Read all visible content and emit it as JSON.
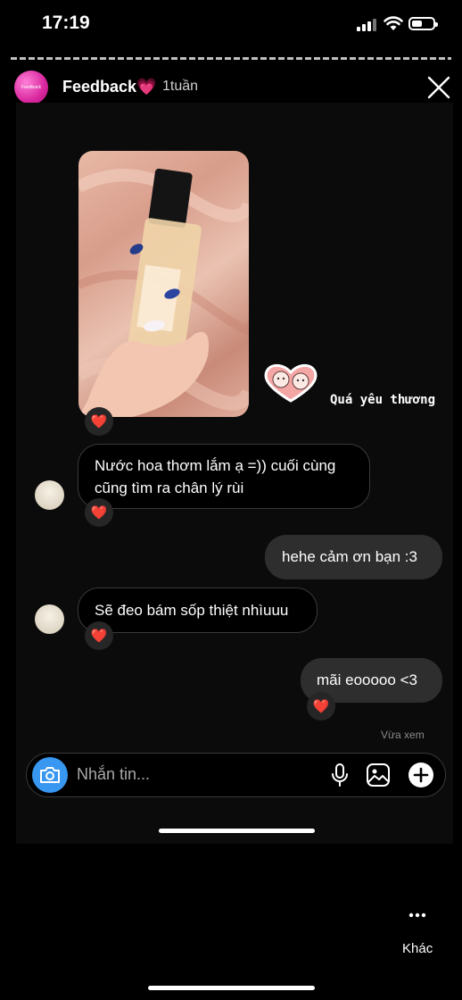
{
  "status_bar": {
    "time": "17:19"
  },
  "header": {
    "account_name": "Feedback💗",
    "avatar_text": "Feedback",
    "age": "1tuần"
  },
  "sticker": {
    "text": "Quá yêu thương"
  },
  "messages": [
    {
      "text": "Nước hoa thơm lắm ạ =)) cuối cùng cũng tìm ra chân lý rùi",
      "direction": "incoming"
    },
    {
      "text": "hehe cảm ơn bạn :3",
      "direction": "outgoing"
    },
    {
      "text": "Sẽ đeo bám sốp thiệt nhìuuu",
      "direction": "incoming"
    },
    {
      "text": "mãi eooooo <3",
      "direction": "outgoing"
    }
  ],
  "reaction": "❤️",
  "seen_label": "Vừa xem",
  "composer": {
    "placeholder": "Nhắn tin..."
  },
  "footer": {
    "more_label": "Khác"
  },
  "colors": {
    "background": "#000000",
    "camera_button": "#3897f0",
    "outgoing_bubble": "#2e2e2e"
  }
}
